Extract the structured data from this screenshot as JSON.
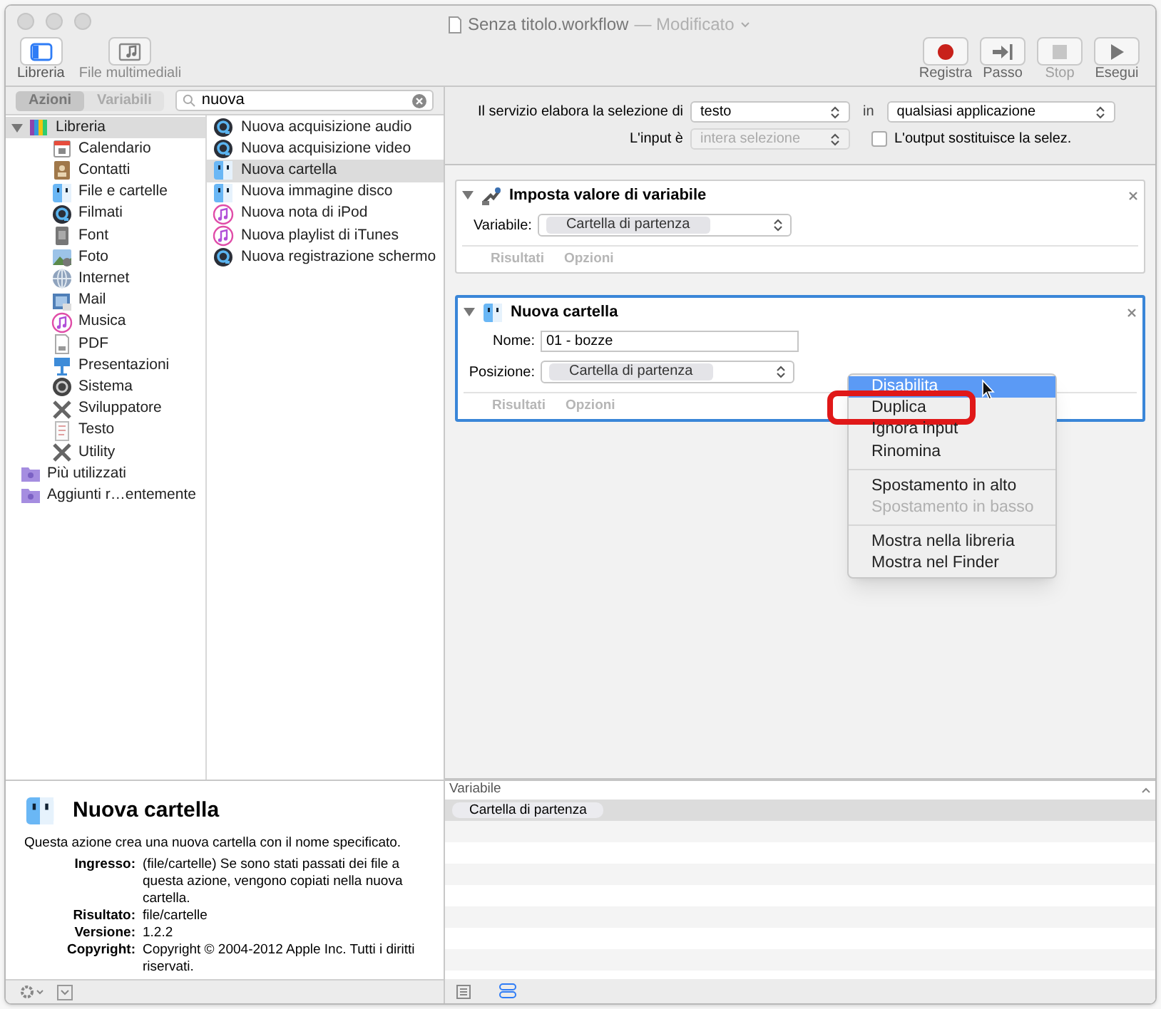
{
  "window": {
    "title": "Senza titolo.workflow",
    "subtitle": "— Modificato"
  },
  "toolbar_left": [
    {
      "label": "Libreria",
      "kind": "sidebar",
      "selected": true
    },
    {
      "label": "File multimediali",
      "kind": "media",
      "selected": false
    }
  ],
  "toolbar_right": [
    {
      "label": "Registra",
      "kind": "record",
      "disabled": false
    },
    {
      "label": "Passo",
      "kind": "step",
      "disabled": false
    },
    {
      "label": "Stop",
      "kind": "stop",
      "disabled": true
    },
    {
      "label": "Esegui",
      "kind": "run",
      "disabled": false
    }
  ],
  "library_tabs": [
    {
      "label": "Azioni",
      "selected": true
    },
    {
      "label": "Variabili",
      "selected": false
    }
  ],
  "search": {
    "value": "nuova"
  },
  "library": [
    {
      "label": "Libreria",
      "kind": "books",
      "expanded": true,
      "selected": true,
      "children": [
        {
          "label": "Calendario",
          "kind": "calendar",
          "selected": false
        },
        {
          "label": "Contatti",
          "kind": "contacts",
          "selected": false
        },
        {
          "label": "File e cartelle",
          "kind": "finder",
          "selected": false
        },
        {
          "label": "Filmati",
          "kind": "quicktime",
          "selected": false
        },
        {
          "label": "Font",
          "kind": "font",
          "selected": false
        },
        {
          "label": "Foto",
          "kind": "photo",
          "selected": false
        },
        {
          "label": "Internet",
          "kind": "globe",
          "selected": false
        },
        {
          "label": "Mail",
          "kind": "mail",
          "selected": false
        },
        {
          "label": "Musica",
          "kind": "music",
          "selected": false
        },
        {
          "label": "PDF",
          "kind": "pdf",
          "selected": false
        },
        {
          "label": "Presentazioni",
          "kind": "keynote",
          "selected": false
        },
        {
          "label": "Sistema",
          "kind": "system",
          "selected": false
        },
        {
          "label": "Sviluppatore",
          "kind": "tools",
          "selected": false
        },
        {
          "label": "Testo",
          "kind": "text",
          "selected": false
        },
        {
          "label": "Utility",
          "kind": "tools",
          "selected": false
        }
      ]
    },
    {
      "label": "Più utilizzati",
      "kind": "smart",
      "selected": false
    },
    {
      "label": "Aggiunti r…entemente",
      "kind": "smart",
      "selected": false
    }
  ],
  "actions": [
    {
      "label": "Nuova acquisizione audio",
      "kind": "quicktime",
      "selected": false
    },
    {
      "label": "Nuova acquisizione video",
      "kind": "quicktime",
      "selected": false
    },
    {
      "label": "Nuova cartella",
      "kind": "finder",
      "selected": true
    },
    {
      "label": "Nuova immagine disco",
      "kind": "finder",
      "selected": false
    },
    {
      "label": "Nuova nota di iPod",
      "kind": "music",
      "selected": false
    },
    {
      "label": "Nuova playlist di iTunes",
      "kind": "music",
      "selected": false
    },
    {
      "label": "Nuova registrazione schermo",
      "kind": "quicktime",
      "selected": false
    }
  ],
  "description": {
    "title": "Nuova cartella",
    "summary": "Questa azione crea una nuova cartella con il nome specificato.",
    "fields": [
      {
        "label": "Ingresso:",
        "value": "(file/cartelle) Se sono stati passati dei file a questa azione, vengono copiati nella nuova cartella."
      },
      {
        "label": "Risultato:",
        "value": "file/cartelle"
      },
      {
        "label": "Versione:",
        "value": "1.2.2"
      },
      {
        "label": "Copyright:",
        "value": "Copyright © 2004-2012 Apple Inc. Tutti i diritti riservati."
      }
    ]
  },
  "service": {
    "label": "Il servizio elabora la selezione di",
    "input_type": "testo",
    "in_label": "in",
    "application": "qualsiasi applicazione",
    "input_label": "L'input è",
    "input_value": "intera selezione",
    "input_disabled": true,
    "replace_label": "L'output sostituisce la selez.",
    "replace_checked": false
  },
  "workflow": [
    {
      "title": "Imposta valore di variabile",
      "kind": "variable",
      "expanded": true,
      "selected": false,
      "fields": [
        {
          "label": "Variabile:",
          "kind": "popup",
          "value": "Cartella di partenza"
        }
      ],
      "footer": [
        "Risultati",
        "Opzioni"
      ]
    },
    {
      "title": "Nuova cartella",
      "kind": "finder",
      "expanded": true,
      "selected": true,
      "fields": [
        {
          "label": "Nome:",
          "kind": "text",
          "value": "01 - bozze"
        },
        {
          "label": "Posizione:",
          "kind": "popup",
          "value": "Cartella di partenza"
        }
      ],
      "footer": [
        "Risultati",
        "Opzioni"
      ]
    }
  ],
  "context_menu": [
    {
      "kind": "item",
      "label": "Disabilita",
      "selected": true,
      "disabled": false,
      "annotated": false
    },
    {
      "kind": "item",
      "label": "Duplica",
      "selected": false,
      "disabled": false,
      "annotated": true
    },
    {
      "kind": "item",
      "label": "Ignora input",
      "selected": false,
      "disabled": false,
      "annotated": false
    },
    {
      "kind": "item",
      "label": "Rinomina",
      "selected": false,
      "disabled": false,
      "annotated": false
    },
    {
      "kind": "separator"
    },
    {
      "kind": "item",
      "label": "Spostamento in alto",
      "selected": false,
      "disabled": false,
      "annotated": false
    },
    {
      "kind": "item",
      "label": "Spostamento in basso",
      "selected": false,
      "disabled": true,
      "annotated": false
    },
    {
      "kind": "separator"
    },
    {
      "kind": "item",
      "label": "Mostra nella libreria",
      "selected": false,
      "disabled": false,
      "annotated": false
    },
    {
      "kind": "item",
      "label": "Mostra nel Finder",
      "selected": false,
      "disabled": false,
      "annotated": false
    }
  ],
  "variables_panel": {
    "header": "Variabile",
    "rows": [
      {
        "label": "Cartella di partenza",
        "selected": true
      }
    ]
  }
}
